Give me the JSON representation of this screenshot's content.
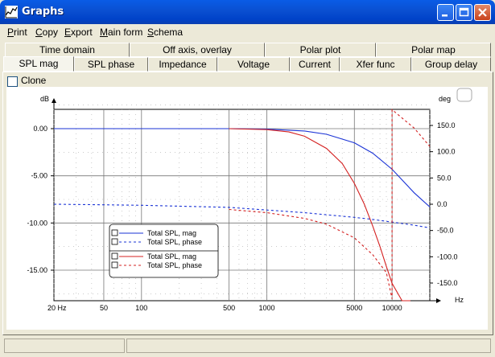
{
  "window": {
    "title": "Graphs",
    "icon": "graph-app-icon"
  },
  "menu": {
    "items": [
      {
        "label": "Print",
        "mnemonic": "P"
      },
      {
        "label": "Copy",
        "mnemonic": "C"
      },
      {
        "label": "Export",
        "mnemonic": "E"
      },
      {
        "label": "Main form",
        "mnemonic": "M"
      },
      {
        "label": "Schema",
        "mnemonic": "S"
      }
    ]
  },
  "tabs": {
    "row1": [
      "Time domain",
      "Off axis, overlay",
      "Polar plot",
      "Polar map"
    ],
    "row2": [
      "SPL mag",
      "SPL phase",
      "Impedance",
      "Voltage",
      "Current",
      "Xfer func",
      "Group delay"
    ],
    "active": "SPL mag"
  },
  "clone": {
    "label": "Clone",
    "checked": false
  },
  "colors": {
    "blue": "#1A33D6",
    "red": "#D42020",
    "titlebar": "#0A4FD1"
  },
  "chart_data": {
    "type": "line",
    "y_left_label": "dB",
    "y_right_label": "deg",
    "x_label": "Hz",
    "x_scale": "log",
    "xlim": [
      20,
      20000
    ],
    "ylim_left": [
      -18.5,
      2
    ],
    "ylim_right": [
      -185,
      175
    ],
    "x_ticks": [
      "20 Hz",
      "50",
      "100",
      "500",
      "1000",
      "5000",
      "10000"
    ],
    "y_left_ticks": [
      "0.00",
      "-5.00",
      "-10.00",
      "-15.00"
    ],
    "y_right_ticks": [
      "150.0",
      "100.0",
      "50.0",
      "0.0",
      "-50.0",
      "-100.0",
      "-150.0"
    ],
    "grid": true,
    "legend": [
      {
        "name": "Total SPL, mag",
        "color": "#1A33D6",
        "style": "solid"
      },
      {
        "name": "Total SPL, phase",
        "color": "#1A33D6",
        "style": "dashed"
      },
      {
        "name": "Total SPL, mag",
        "color": "#D42020",
        "style": "solid"
      },
      {
        "name": "Total SPL, phase",
        "color": "#D42020",
        "style": "dashed"
      }
    ],
    "series": [
      {
        "name": "Total SPL, mag",
        "axis": "left",
        "color": "#1A33D6",
        "style": "solid",
        "x": [
          20,
          100,
          500,
          1000,
          2000,
          3000,
          5000,
          7000,
          10000,
          15000,
          20000
        ],
        "y": [
          0,
          0,
          0,
          -0.05,
          -0.25,
          -0.6,
          -1.5,
          -2.6,
          -4.3,
          -6.8,
          -8.3
        ]
      },
      {
        "name": "Total SPL, phase",
        "axis": "right",
        "color": "#1A33D6",
        "style": "dashed",
        "x": [
          20,
          50,
          100,
          500,
          1000,
          2000,
          3000,
          5000,
          7000,
          10000,
          15000,
          20000
        ],
        "y": [
          0,
          -1,
          -2,
          -6,
          -11,
          -16,
          -20,
          -25,
          -29,
          -34,
          -40,
          -45
        ]
      },
      {
        "name": "Total SPL, mag",
        "axis": "left",
        "color": "#D42020",
        "style": "solid",
        "x": [
          500,
          1000,
          1500,
          2000,
          3000,
          4000,
          5000,
          6000,
          7000,
          8000,
          9000,
          10000,
          12000,
          14000
        ],
        "y": [
          0,
          -0.1,
          -0.35,
          -0.8,
          -2.1,
          -3.7,
          -5.8,
          -8.0,
          -10.3,
          -12.5,
          -14.6,
          -16.4,
          -18.5,
          -19.5
        ]
      },
      {
        "name": "Total SPL, phase",
        "axis": "right",
        "color": "#D42020",
        "style": "dashed",
        "x": [
          500,
          1000,
          2000,
          3000,
          5000,
          7000,
          9000,
          10000,
          10001,
          15000,
          20000
        ],
        "y": [
          -10,
          -16,
          -27,
          -38,
          -64,
          -96,
          -130,
          -180,
          180,
          145,
          110
        ]
      }
    ]
  }
}
